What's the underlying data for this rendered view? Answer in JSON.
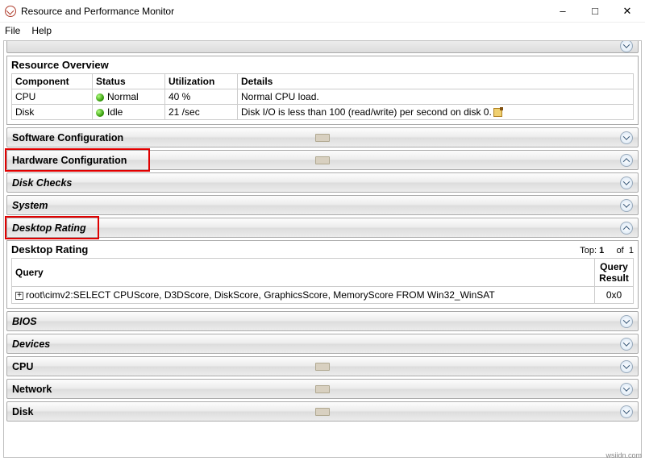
{
  "window": {
    "title": "Resource and Performance Monitor"
  },
  "menu": {
    "file": "File",
    "help": "Help"
  },
  "overview": {
    "title": "Resource Overview",
    "headers": {
      "component": "Component",
      "status": "Status",
      "utilization": "Utilization",
      "details": "Details"
    },
    "rows": [
      {
        "component": "CPU",
        "status": "Normal",
        "utilization": "40 %",
        "details": "Normal CPU load."
      },
      {
        "component": "Disk",
        "status": "Idle",
        "utilization": "21 /sec",
        "details": "Disk I/O is less than 100 (read/write) per second on disk 0."
      }
    ]
  },
  "sections": {
    "software": "Software Configuration",
    "hardware": "Hardware Configuration",
    "diskchecks": "Disk Checks",
    "system": "System",
    "desktop_rating": "Desktop Rating",
    "bios": "BIOS",
    "devices": "Devices",
    "cpu": "CPU",
    "network": "Network",
    "disk": "Disk"
  },
  "rating": {
    "title": "Desktop Rating",
    "top_label": "Top:",
    "top_value": "1",
    "of_label": "of",
    "of_value": "1",
    "headers": {
      "query": "Query",
      "result": "Query Result"
    },
    "rows": [
      {
        "query": "root\\cimv2:SELECT CPUScore, D3DScore, DiskScore, GraphicsScore, MemoryScore FROM Win32_WinSAT",
        "result": "0x0"
      }
    ]
  },
  "watermark": "wsiidn.com"
}
